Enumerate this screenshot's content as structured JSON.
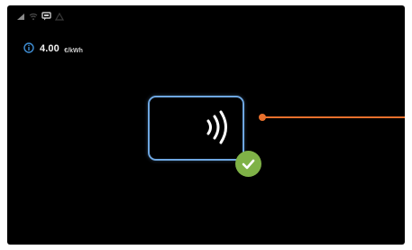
{
  "status_bar": {
    "icons": [
      "signal-icon",
      "wifi-icon",
      "chat-icon",
      "warning-icon"
    ]
  },
  "price": {
    "icon": "info-icon",
    "value": "4.00",
    "unit": "€/kWh"
  },
  "card_reader": {
    "icon": "contactless-card-icon",
    "status_icon": "check-icon",
    "status_color": "#7fb247",
    "card_color": "#6ea6e0"
  },
  "callout": {
    "color": "#e8702c"
  }
}
